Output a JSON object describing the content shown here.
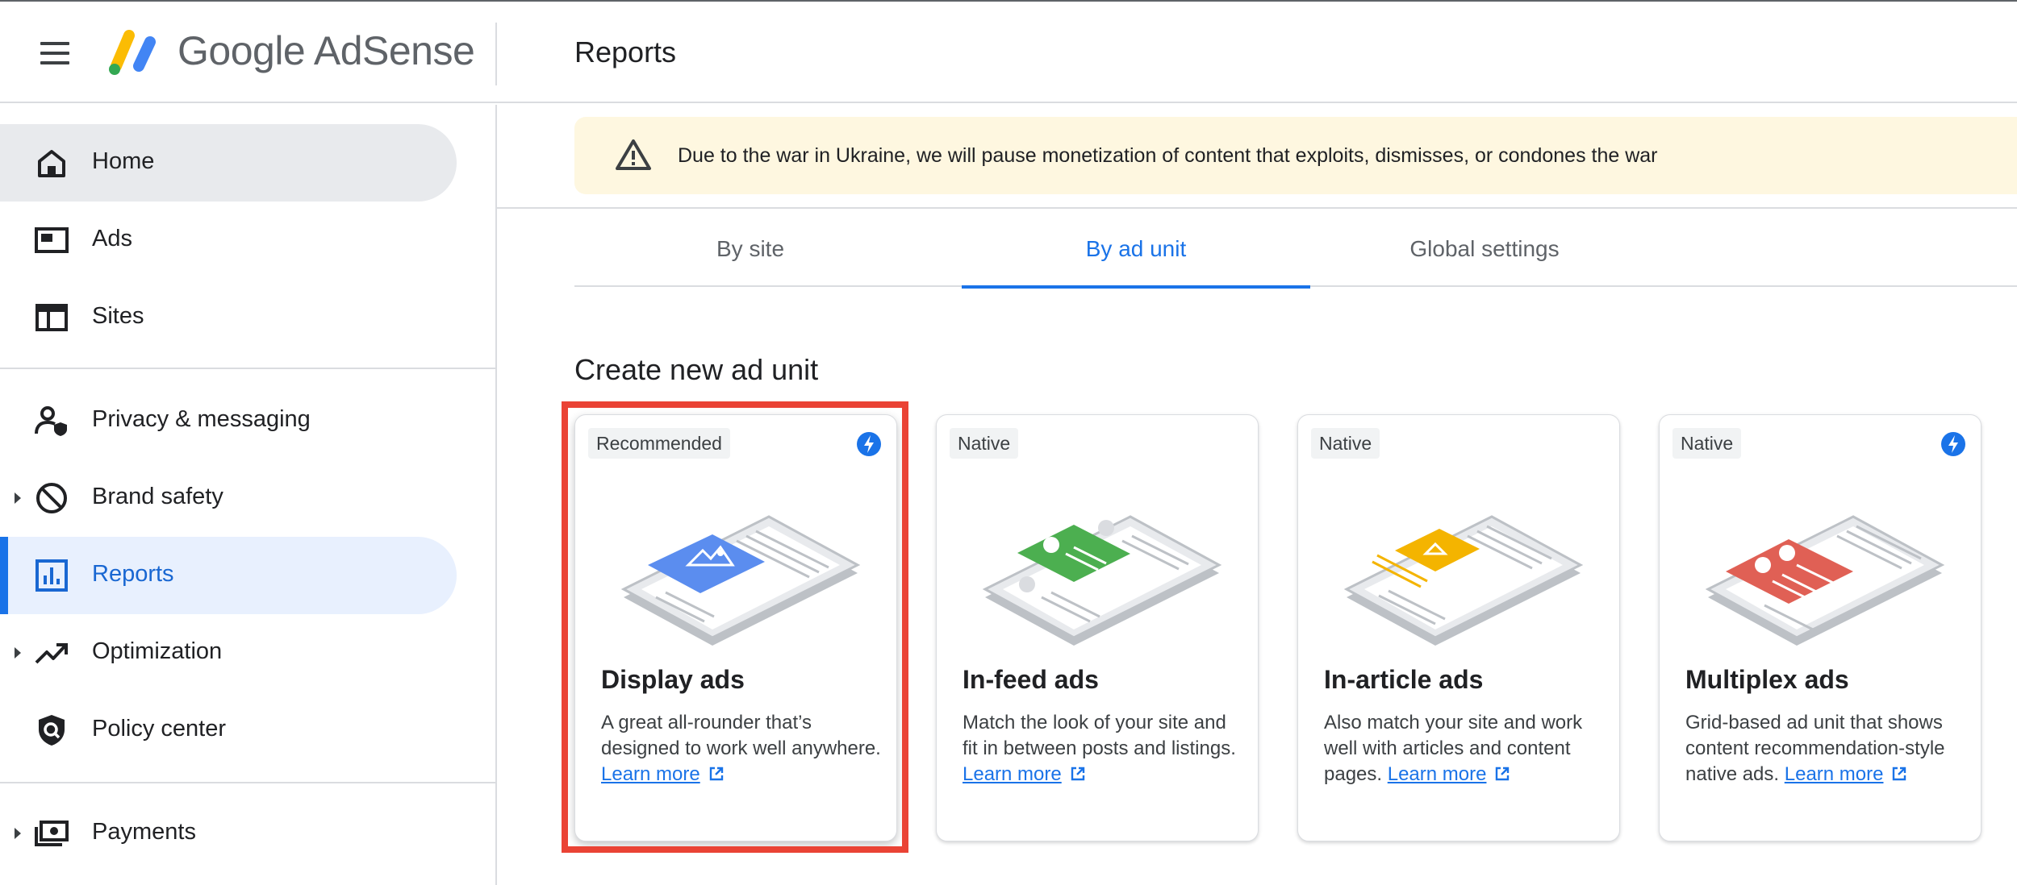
{
  "app": {
    "brand": "Google AdSense",
    "page_title": "Reports"
  },
  "sidebar": {
    "items": [
      {
        "label": "Home",
        "icon": "home-icon"
      },
      {
        "label": "Ads",
        "icon": "ads-icon"
      },
      {
        "label": "Sites",
        "icon": "sites-icon"
      },
      {
        "label": "Privacy & messaging",
        "icon": "privacy-icon"
      },
      {
        "label": "Brand safety",
        "icon": "block-icon"
      },
      {
        "label": "Reports",
        "icon": "reports-icon"
      },
      {
        "label": "Optimization",
        "icon": "trending-up-icon"
      },
      {
        "label": "Policy center",
        "icon": "policy-shield-icon"
      },
      {
        "label": "Payments",
        "icon": "payments-icon"
      }
    ]
  },
  "banner": {
    "text": "Due to the war in Ukraine, we will pause monetization of content that exploits, dismisses, or condones the war",
    "icon": "warning-icon"
  },
  "tabs": [
    {
      "label": "By site"
    },
    {
      "label": "By ad unit",
      "active": true
    },
    {
      "label": "Global settings"
    }
  ],
  "section": {
    "title": "Create new ad unit"
  },
  "cards": [
    {
      "chip": "Recommended",
      "title": "Display ads",
      "desc": "A great all-rounder that’s designed to work well anywhere.",
      "link": "Learn more",
      "color": "#5b8def",
      "bolt": true
    },
    {
      "chip": "Native",
      "title": "In-feed ads",
      "desc": "Match the look of your site and fit in between posts and listings.",
      "link": "Learn more",
      "color": "#4caf50",
      "bolt": false
    },
    {
      "chip": "Native",
      "title": "In-article ads",
      "desc": "Also match your site and work well with articles and content pages.",
      "link": "Learn more",
      "color": "#f4b400",
      "bolt": false
    },
    {
      "chip": "Native",
      "title": "Multiplex ads",
      "desc": "Grid-based ad unit that shows content recommendation-style native ads.",
      "link": "Learn more",
      "color": "#e06055",
      "bolt": true
    }
  ],
  "colors": {
    "accent": "#1a73e8",
    "highlight": "#ea4335",
    "banner_bg": "#fef7e0"
  }
}
